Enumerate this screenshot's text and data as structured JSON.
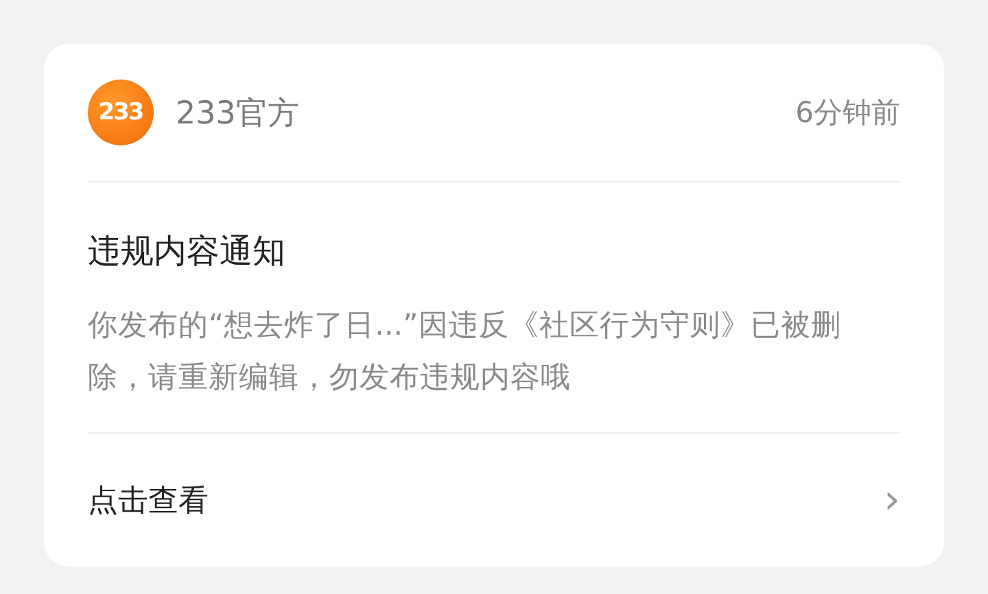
{
  "header": {
    "logo_text": "233",
    "sender": "233官方",
    "time": "6分钟前"
  },
  "notice": {
    "title": "违规内容通知",
    "body": "你发布的“想去炸了日...”因违反《社区行为守则》已被删除，请重新编辑，勿发布违规内容哦"
  },
  "footer": {
    "link": "点击查看",
    "chevron": "›"
  }
}
